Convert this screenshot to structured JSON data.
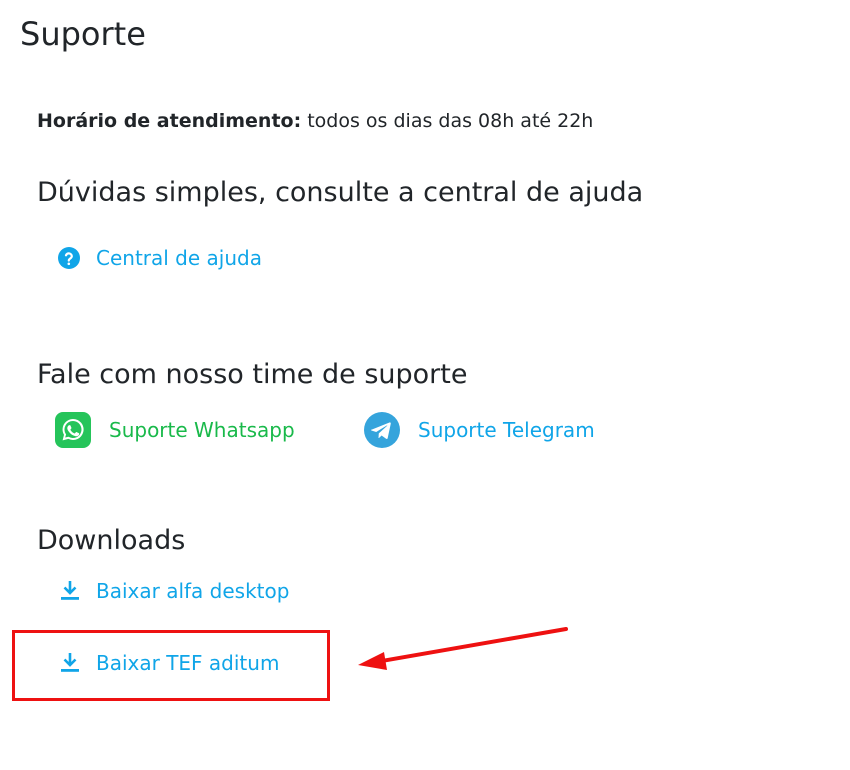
{
  "page_title": "Suporte",
  "hours": {
    "label": "Horário de atendimento:",
    "value": " todos os dias das 08h até 22h"
  },
  "help_section": {
    "heading": "Dúvidas simples, consulte a central de ajuda",
    "link_label": "Central de ajuda",
    "icon": "question-circle-icon"
  },
  "contact_section": {
    "heading": "Fale com nosso time de suporte",
    "whatsapp_label": "Suporte Whatsapp",
    "telegram_label": "Suporte Telegram",
    "whatsapp_icon": "whatsapp-icon",
    "telegram_icon": "telegram-icon"
  },
  "downloads_section": {
    "heading": "Downloads",
    "items": [
      {
        "label": "Baixar alfa desktop",
        "icon": "download-icon"
      },
      {
        "label": "Baixar TEF aditum",
        "icon": "download-icon"
      }
    ]
  },
  "colors": {
    "link_blue": "#10a5e8",
    "whatsapp_green": "#19b94a",
    "highlight_red": "#ee1111"
  }
}
